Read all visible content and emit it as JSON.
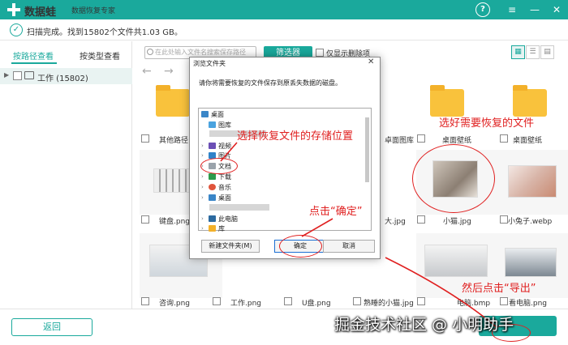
{
  "titlebar": {
    "app_name": "数据蛙",
    "app_subtitle": "数据恢复专家",
    "help": "?",
    "menu": "≡",
    "minimize": "—",
    "close": "✕"
  },
  "status": {
    "text": "扫描完成。找到15802个文件共1.03 GB。"
  },
  "left_tabs": [
    "按路径查看",
    "按类型查看"
  ],
  "tree": {
    "label": "工作 (15802)"
  },
  "search": {
    "placeholder": "在此处输入文件名搜索保存路径"
  },
  "filter_button": "筛选器",
  "only_deleted": "仅显示删除项",
  "view_buttons": [
    "▦",
    "☰",
    "▤"
  ],
  "files": {
    "row1": [
      "其他路径",
      "",
      "",
      "卓面图库",
      "桌面壁纸",
      "桌面壁纸"
    ],
    "row2": [
      "键盘.png",
      "",
      "",
      "大.jpg",
      "小猫.jpg",
      "小兔子.webp"
    ],
    "row3": [
      "咨询.png",
      "工作.png",
      "U盘.png",
      "熟睡的小猫.jpg",
      "电脑.bmp",
      "看电脑.png"
    ]
  },
  "dialog": {
    "title": "浏览文件夹",
    "close": "✕",
    "description": "请你将需要恢复的文件保存到原丢失数据的磁盘。",
    "tree_items": [
      "桌面",
      "图库",
      "视频",
      "图片",
      "文档",
      "下载",
      "音乐",
      "桌面",
      "此电脑",
      "库"
    ],
    "new_folder": "新建文件夹(M)",
    "ok": "确定",
    "cancel": "取消"
  },
  "annotations": {
    "pick_location": "选择恢复文件的存储位置",
    "pick_files": "选好需要恢复的文件",
    "click_ok": "点击“确定”",
    "click_export": "然后点击“导出”"
  },
  "back_button": "返回",
  "watermark": "掘金技术社区 @ 小明助手",
  "colors": {
    "accent": "#1aa99c",
    "annotation": "#e02020",
    "folder": "#f9c23c"
  }
}
